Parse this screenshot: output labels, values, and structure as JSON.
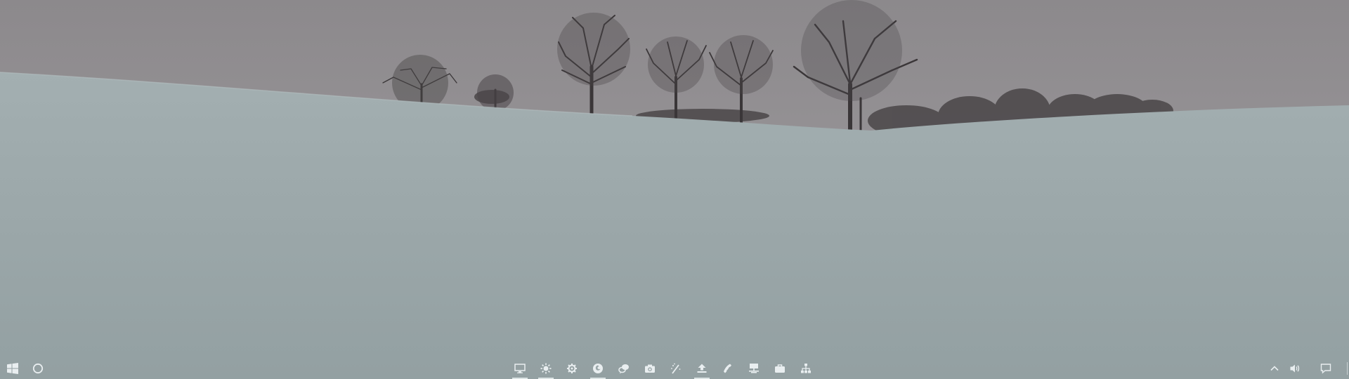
{
  "desktop": {
    "wallpaper": "snowy-hill-with-bare-trees",
    "colors": {
      "sky": "#8f8c8f",
      "snow": "#9ba8aa",
      "trees": "#3a3638",
      "taskbar_icon": "#e9eef0"
    }
  },
  "taskbar": {
    "start": {
      "icon": "windows-logo-icon"
    },
    "search": {
      "icon": "cortana-circle-icon"
    },
    "pinned": [
      {
        "id": "desktop",
        "icon": "monitor-icon",
        "running": true
      },
      {
        "id": "settings-alt",
        "icon": "sun-gear-icon",
        "running": true
      },
      {
        "id": "settings",
        "icon": "gear-icon",
        "running": false
      },
      {
        "id": "firefox",
        "icon": "firefox-icon",
        "running": true
      },
      {
        "id": "chat",
        "icon": "chat-bubbles-icon",
        "running": false
      },
      {
        "id": "camera",
        "icon": "camera-icon",
        "running": false
      },
      {
        "id": "tools",
        "icon": "wand-icon",
        "running": false
      },
      {
        "id": "upload",
        "icon": "upload-icon",
        "running": true
      },
      {
        "id": "phone",
        "icon": "phone-icon",
        "running": false
      },
      {
        "id": "network-drive",
        "icon": "server-icon",
        "running": false
      },
      {
        "id": "briefcase",
        "icon": "briefcase-icon",
        "running": false
      },
      {
        "id": "network",
        "icon": "network-tree-icon",
        "running": false
      }
    ],
    "tray": {
      "chevron": {
        "icon": "chevron-up-icon"
      },
      "volume": {
        "icon": "speaker-icon"
      },
      "notifications": {
        "icon": "action-center-icon"
      }
    }
  }
}
